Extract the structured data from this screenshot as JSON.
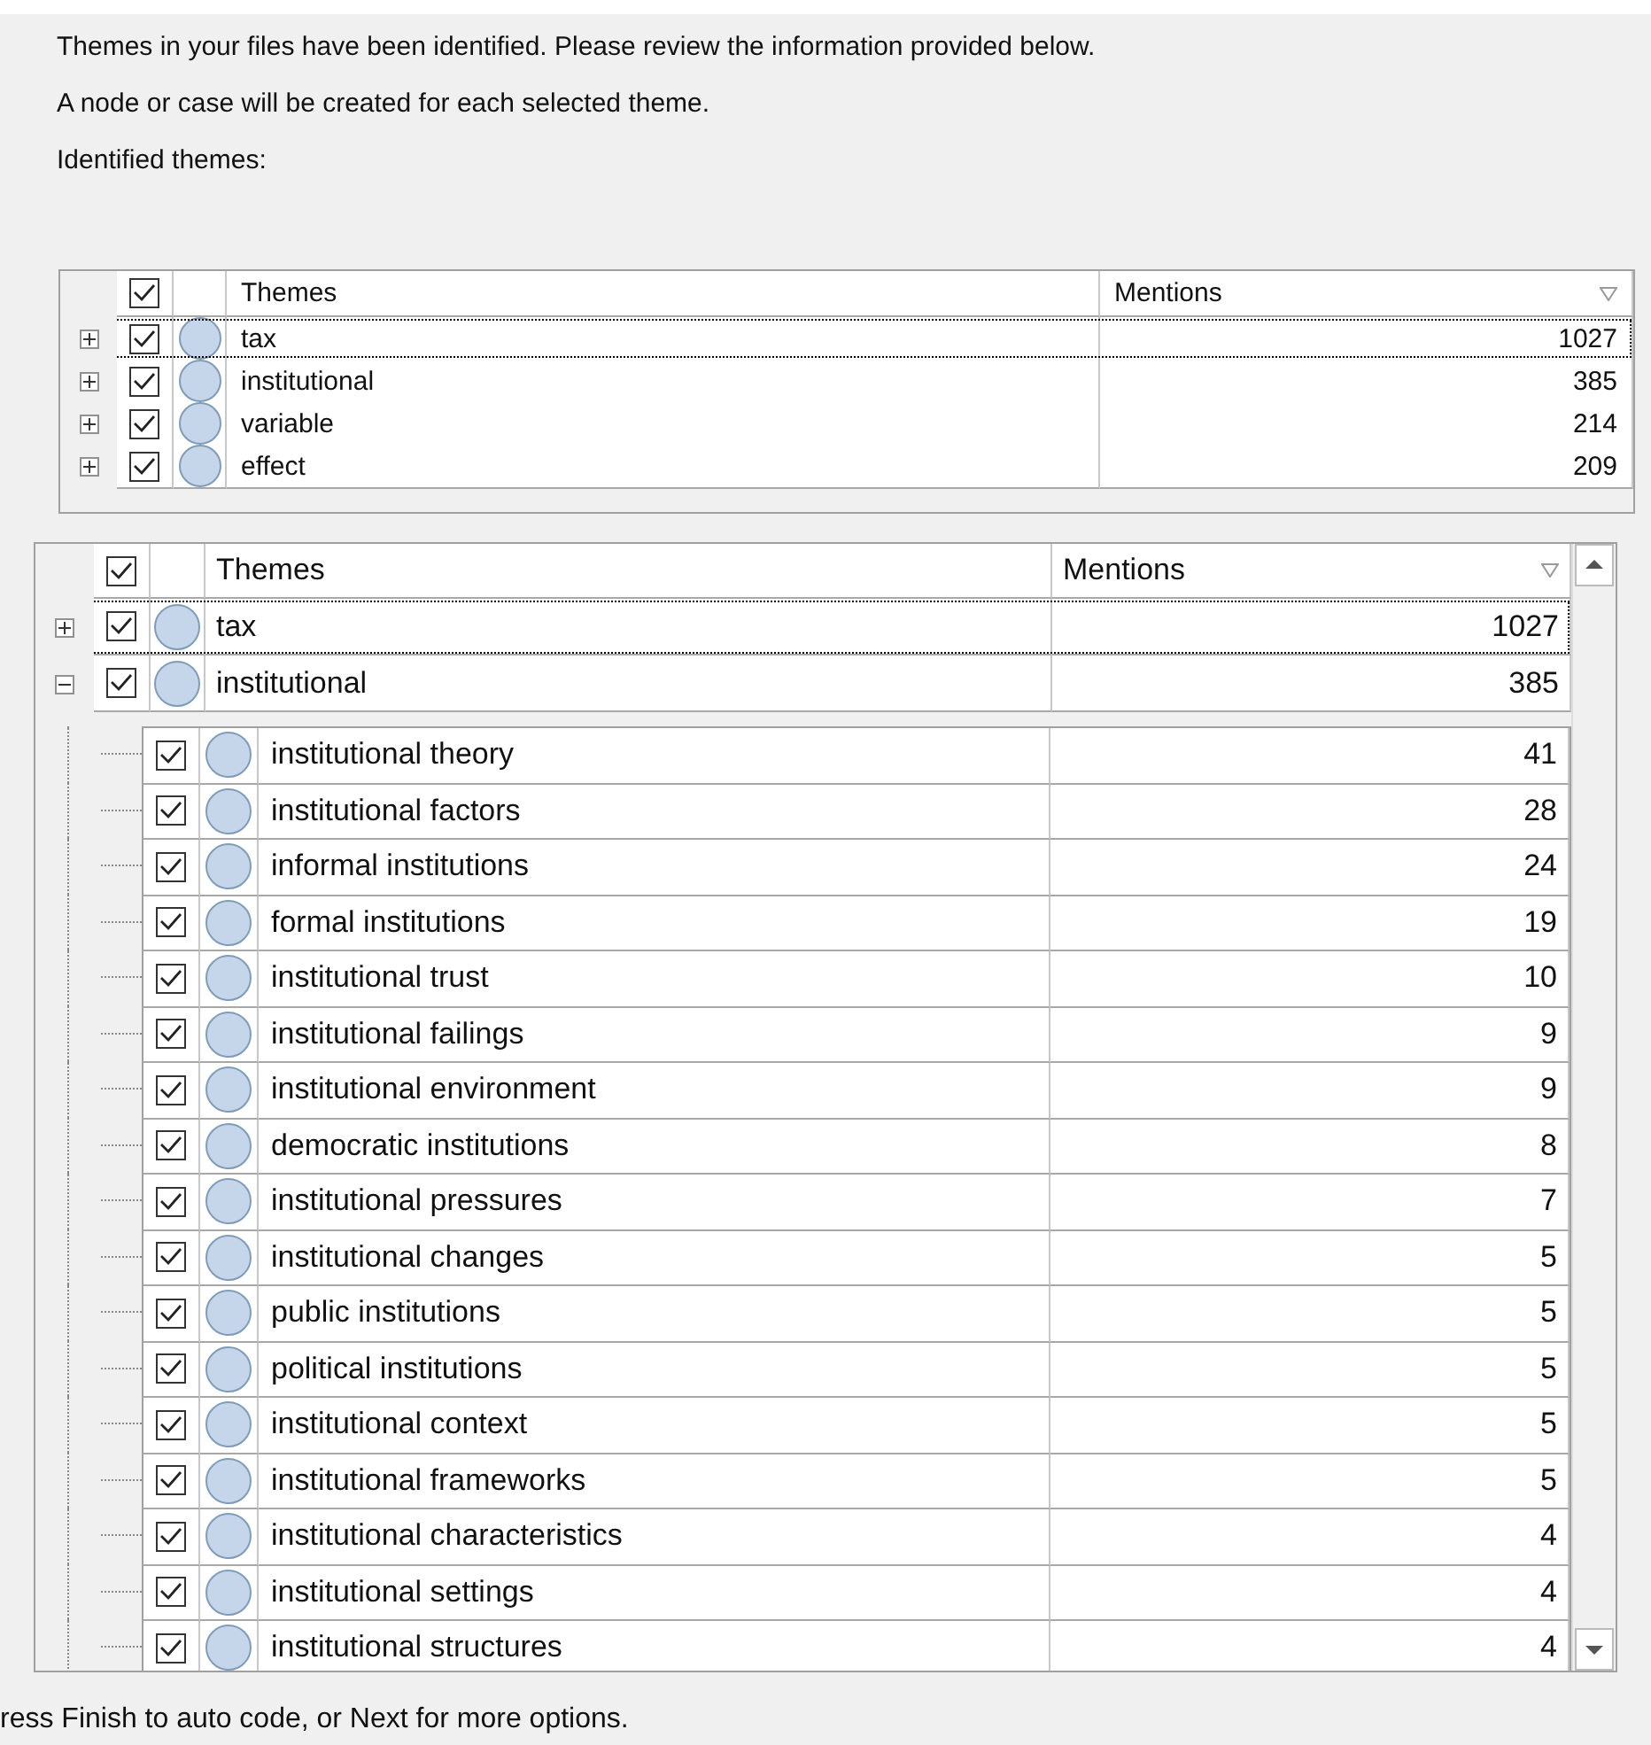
{
  "intro": [
    "Themes in your files have been identified. Please review the information provided below.",
    "A node or case will be created for each selected theme.",
    "Identified themes:"
  ],
  "grid_top": {
    "all_checked": true,
    "columns": [
      "Themes",
      "Mentions"
    ],
    "rows": [
      {
        "theme": "tax",
        "mentions": "1027",
        "checked": true,
        "expanded": false,
        "selected": true
      },
      {
        "theme": "institutional",
        "mentions": "385",
        "checked": true,
        "expanded": false,
        "selected": false
      },
      {
        "theme": "variable",
        "mentions": "214",
        "checked": true,
        "expanded": false,
        "selected": false
      },
      {
        "theme": "effect",
        "mentions": "209",
        "checked": true,
        "expanded": false,
        "selected": false
      }
    ]
  },
  "grid_main": {
    "all_checked": true,
    "columns": [
      "Themes",
      "Mentions"
    ],
    "rows": [
      {
        "theme": "tax",
        "mentions": "1027",
        "checked": true,
        "expanded": false,
        "selected": true
      },
      {
        "theme": "institutional",
        "mentions": "385",
        "checked": true,
        "expanded": true,
        "selected": false,
        "children": [
          {
            "theme": "institutional theory",
            "mentions": "41",
            "checked": true
          },
          {
            "theme": "institutional factors",
            "mentions": "28",
            "checked": true
          },
          {
            "theme": "informal institutions",
            "mentions": "24",
            "checked": true
          },
          {
            "theme": "formal institutions",
            "mentions": "19",
            "checked": true
          },
          {
            "theme": "institutional trust",
            "mentions": "10",
            "checked": true
          },
          {
            "theme": "institutional failings",
            "mentions": "9",
            "checked": true
          },
          {
            "theme": "institutional environment",
            "mentions": "9",
            "checked": true
          },
          {
            "theme": "democratic institutions",
            "mentions": "8",
            "checked": true
          },
          {
            "theme": "institutional pressures",
            "mentions": "7",
            "checked": true
          },
          {
            "theme": "institutional changes",
            "mentions": "5",
            "checked": true
          },
          {
            "theme": "public institutions",
            "mentions": "5",
            "checked": true
          },
          {
            "theme": "political institutions",
            "mentions": "5",
            "checked": true
          },
          {
            "theme": "institutional context",
            "mentions": "5",
            "checked": true
          },
          {
            "theme": "institutional frameworks",
            "mentions": "5",
            "checked": true
          },
          {
            "theme": "institutional characteristics",
            "mentions": "4",
            "checked": true
          },
          {
            "theme": "institutional settings",
            "mentions": "4",
            "checked": true
          },
          {
            "theme": "institutional structures",
            "mentions": "4",
            "checked": true
          }
        ]
      }
    ]
  },
  "footer": "ress Finish to auto code, or Next for more options."
}
